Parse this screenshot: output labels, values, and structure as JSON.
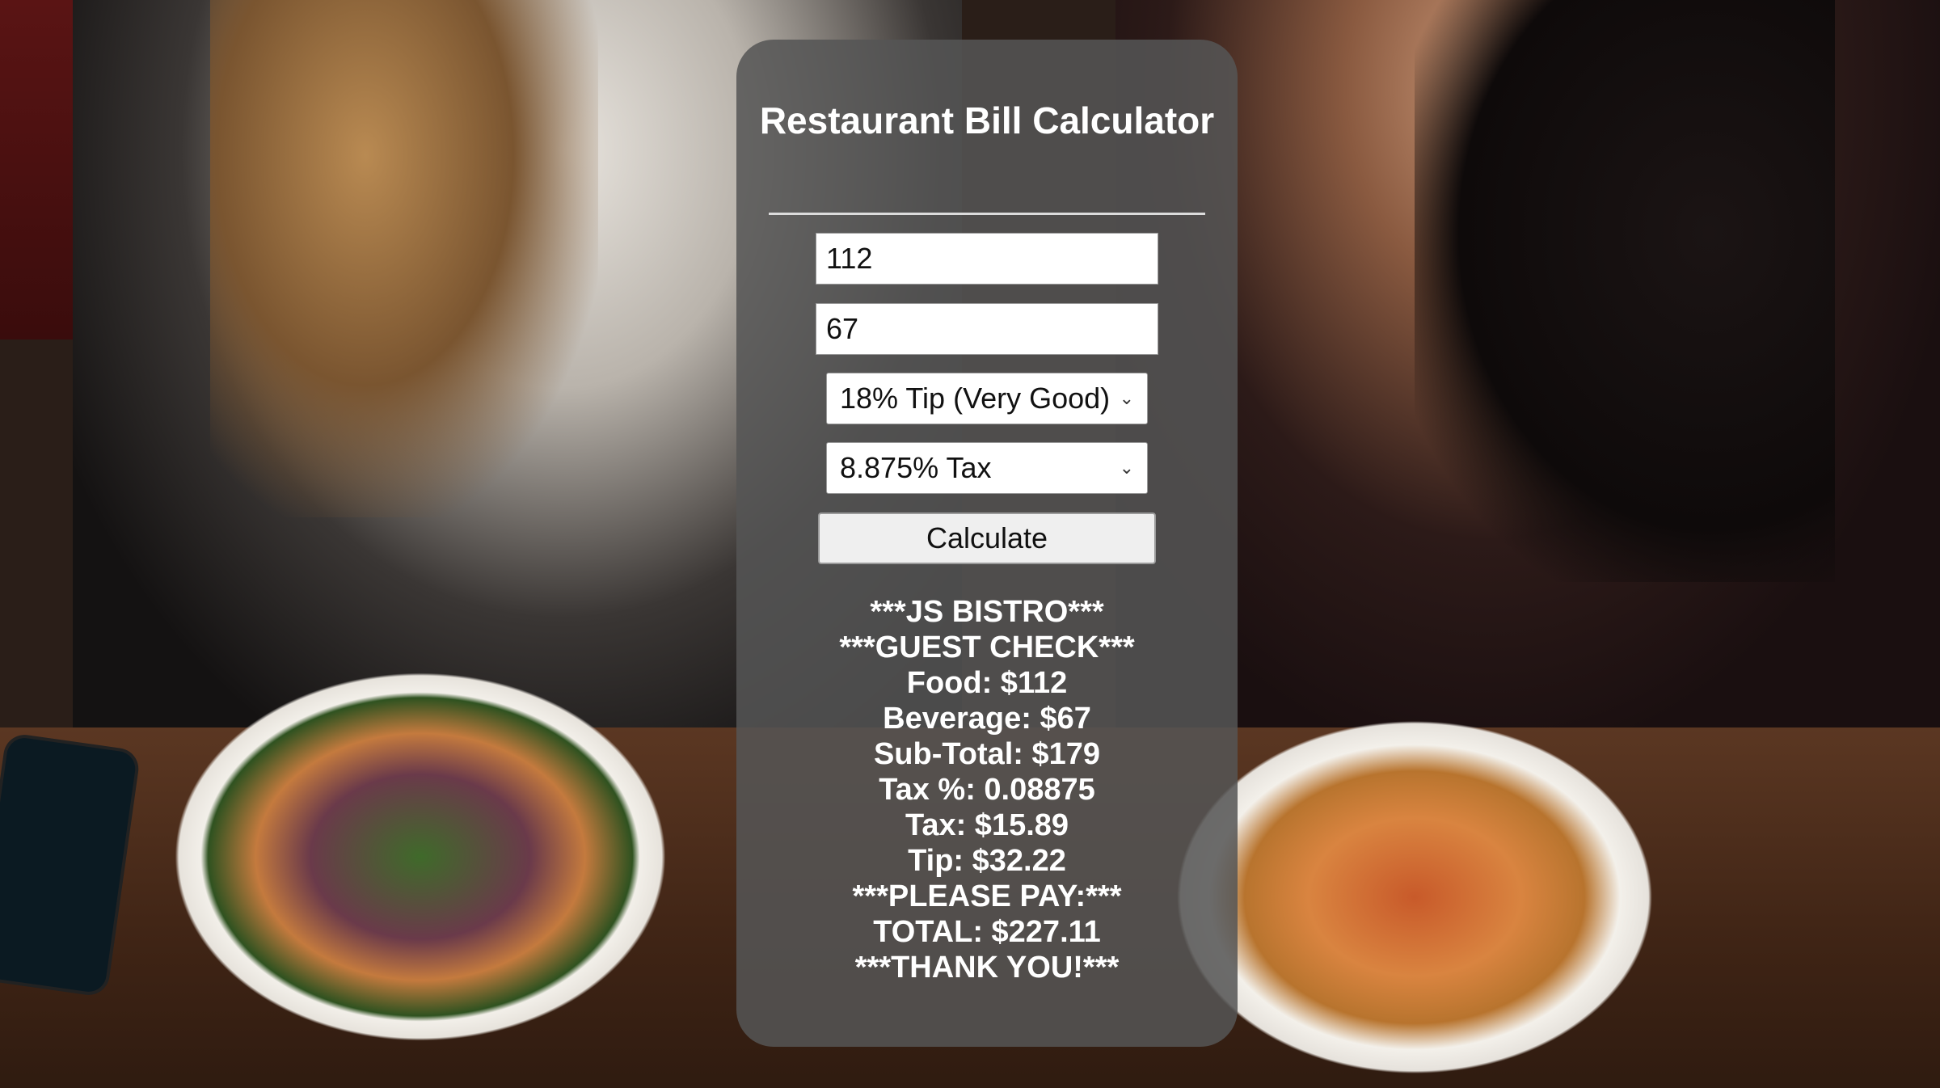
{
  "app": {
    "title": "Restaurant Bill Calculator"
  },
  "form": {
    "food_value": "112",
    "beverage_value": "67",
    "tip_selected": "18% Tip (Very Good)",
    "tax_selected": "8.875% Tax",
    "calculate_label": "Calculate"
  },
  "receipt": {
    "lines": [
      "***JS BISTRO***",
      "***GUEST CHECK***",
      "Food: $112",
      "Beverage: $67",
      "Sub-Total: $179",
      "Tax %: 0.08875",
      "Tax: $15.89",
      "Tip: $32.22",
      "***PLEASE PAY:***",
      "TOTAL: $227.11",
      "***THANK YOU!***"
    ]
  },
  "icons": {
    "dropdown": "chevron-down-icon"
  },
  "colors": {
    "panel_bg": "#555555",
    "text": "#ffffff"
  }
}
